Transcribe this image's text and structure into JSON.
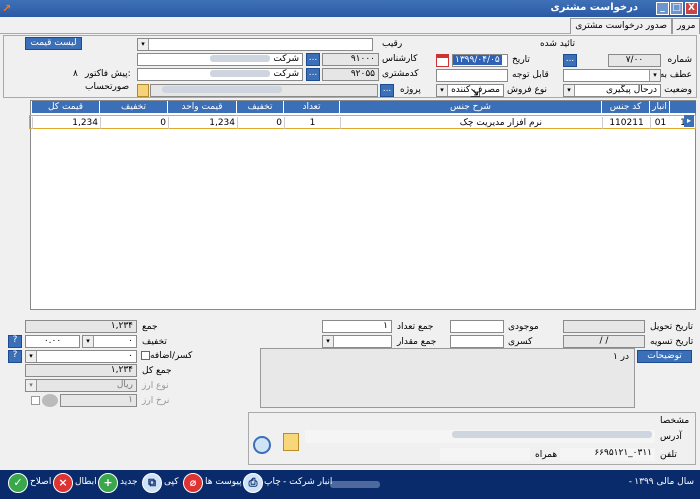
{
  "window": {
    "title": "درخواست مشتری",
    "minimize": "_",
    "restore": "□",
    "close": "X"
  },
  "tabs": [
    "صدور درخواست مشتری",
    "مرور"
  ],
  "header": {
    "approved_label": "تائید شده",
    "number_label": "شماره",
    "number_value": "۷/۰۰",
    "date_label": "تاریخ",
    "date_value": "۱۳۹۹/۰۴/۰۵",
    "ref_label": "عطف به",
    "payable_label": "قابل توجه",
    "status_label": "وضعیت",
    "status_value": "درحال پیگیری",
    "saletype_label": "نوع فروش",
    "saletype_value": "مصرف کننده",
    "rival_label": "رقیب",
    "expert_label": "کارشناس",
    "expert_code": "۹۱۰۰۰",
    "expert_name": "شرکت",
    "customer_label": "کدمشتری",
    "customer_code": "۹۲۰۵۵",
    "customer_name": "شرکت",
    "project_label": "پروژه",
    "price_list_button": "لیست قیمت",
    "proforma_label": "پیش فاکتور:",
    "proforma_value": "۸",
    "account_label": "صورتحساب"
  },
  "grid": {
    "columns": [
      "انبار",
      "کد جنس",
      "شرح جنس",
      "تعداد",
      "تخفیف",
      "قیمت واحد",
      "تخفیف",
      "قیمت کل"
    ],
    "rows": [
      {
        "index": "1",
        "warehouse": "01",
        "code": "110211",
        "desc": "نرم افزار مدیریت چک",
        "qty": "1",
        "disc1": "0",
        "unit_price": "1,234",
        "disc2": "0",
        "total": "1,234"
      }
    ]
  },
  "footer": {
    "delivery_label": "تاریخ تحویل",
    "settle_label": "تاریخ تسویه",
    "settle_value": "/   /",
    "stock_label": "موجودی",
    "deficit_label": "کسری",
    "qty_sum_label": "جمع تعداد",
    "qty_sum_value": "۱",
    "amount_sum_label": "جمع مقدار",
    "sum_label": "جمع",
    "sum_value": "۱,۲۳۴",
    "discount_label": "تخفیف",
    "discount_pct": "۰.۰۰",
    "discount_value": "۰",
    "extra_label": "کسر/اضافه",
    "extra_value": "۰",
    "grand_label": "جمع کل",
    "grand_value": "۱,۲۳۴",
    "currency_type_label": "نوع ارز",
    "currency_type_value": "ریال",
    "rate_label": "نرخ ارز",
    "rate_value": "۱",
    "desc_button": "توضیحات",
    "desc_text": "در ۱",
    "specs_label": "مشخصا",
    "address_label": "آدرس",
    "phone_label": "تلفن",
    "phone_value": "۶۶۹۵۱۲۱_۰۳۱۱",
    "mobile_label": "همراه"
  },
  "status": {
    "year": "سال مالی ۱۳۹۹",
    "warehouse": "- انبار شرکت",
    "separator": "-"
  },
  "toolbar": {
    "print": "چاپ",
    "attachments": "پیوست ها",
    "copy": "کپی",
    "new": "جدید",
    "cancel": "ابطال",
    "edit": "اصلاح"
  }
}
